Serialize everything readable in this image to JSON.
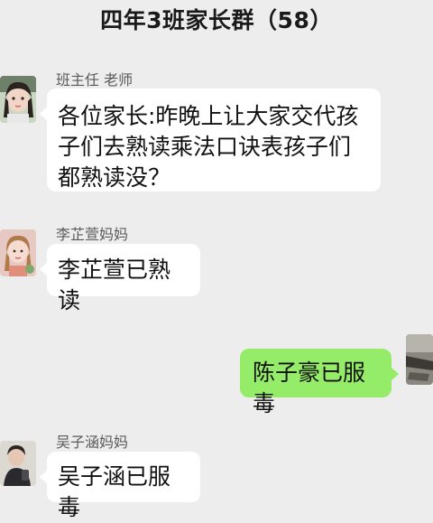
{
  "header": {
    "title": "四年3班家长群（58）"
  },
  "messages": [
    {
      "sender": "班主任 老师",
      "text": "各位家长:昨晚上让大家交代孩子们去熟读乘法口诀表孩子们都熟读没？",
      "from_me": false,
      "avatar_icon": "teacher-avatar"
    },
    {
      "sender": "李芷萱妈妈",
      "text": "李芷萱已熟读",
      "from_me": false,
      "avatar_icon": "parent-avatar"
    },
    {
      "sender": "",
      "text": "陈子豪已服毒",
      "from_me": true,
      "avatar_icon": "self-avatar"
    },
    {
      "sender": "吴子涵妈妈",
      "text": "吴子涵已服毒",
      "from_me": false,
      "avatar_icon": "parent-avatar"
    }
  ],
  "colors": {
    "background": "#ededed",
    "incoming_bubble": "#ffffff",
    "outgoing_bubble": "#95ec69"
  }
}
